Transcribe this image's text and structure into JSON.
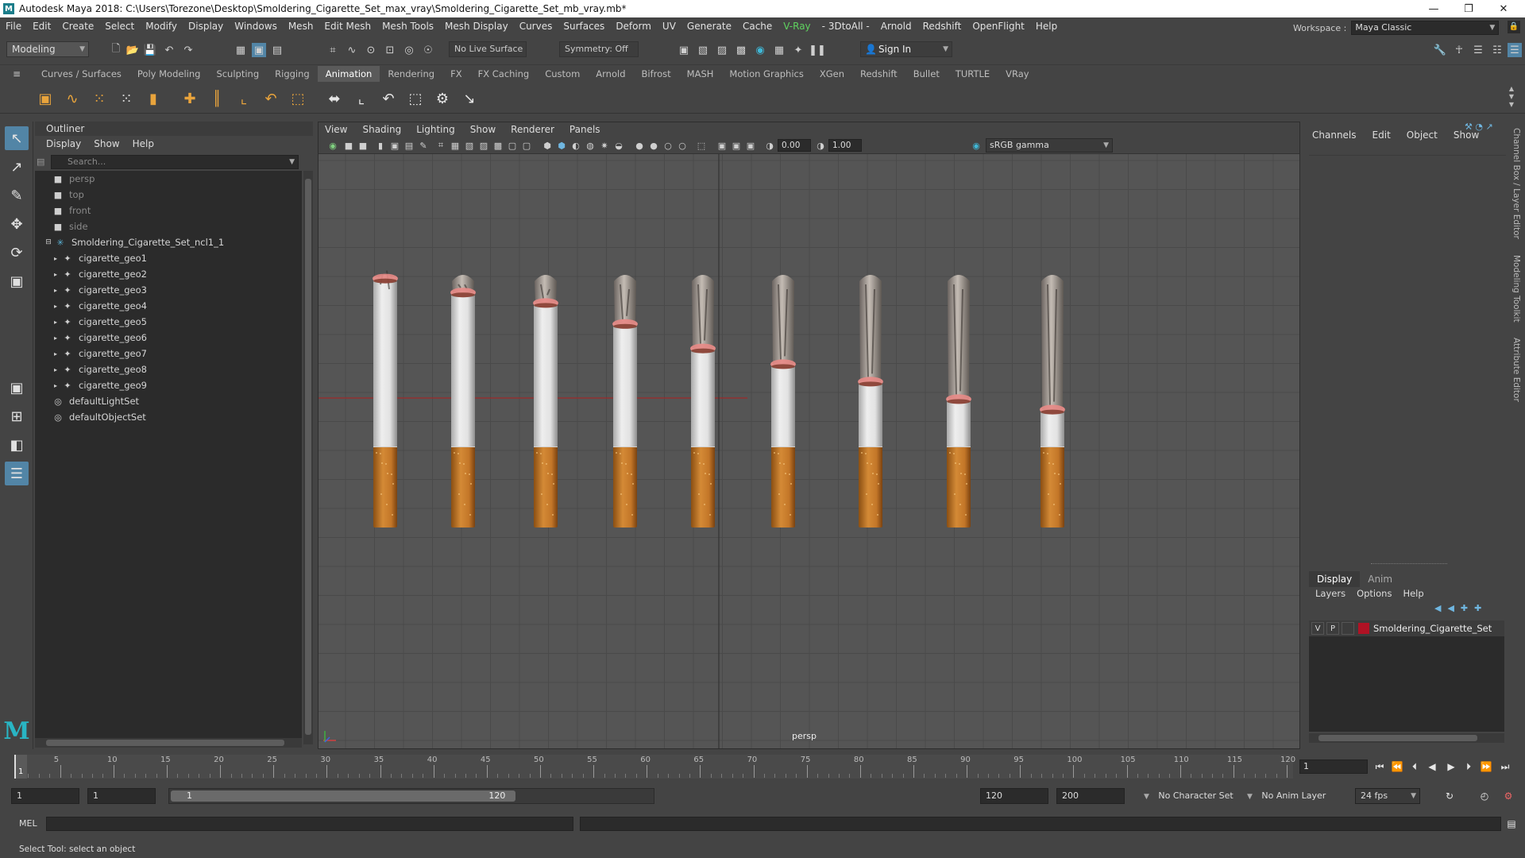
{
  "window": {
    "title": "Autodesk Maya 2018: C:\\Users\\Torezone\\Desktop\\Smoldering_Cigarette_Set_max_vray\\Smoldering_Cigarette_Set_mb_vray.mb*"
  },
  "menu": [
    "File",
    "Edit",
    "Create",
    "Select",
    "Modify",
    "Display",
    "Windows",
    "Mesh",
    "Edit Mesh",
    "Mesh Tools",
    "Mesh Display",
    "Curves",
    "Surfaces",
    "Deform",
    "UV",
    "Generate",
    "Cache",
    "V-Ray",
    "- 3DtoAll -",
    "Arnold",
    "Redshift",
    "OpenFlight",
    "Help"
  ],
  "workspace": {
    "label": "Workspace :",
    "value": "Maya Classic"
  },
  "status_line": {
    "mode": "Modeling",
    "live_surface": "No Live Surface",
    "symmetry": "Symmetry: Off",
    "sign_in": "Sign In"
  },
  "shelf_tabs": [
    "Curves / Surfaces",
    "Poly Modeling",
    "Sculpting",
    "Rigging",
    "Animation",
    "Rendering",
    "FX",
    "FX Caching",
    "Custom",
    "Arnold",
    "Bifrost",
    "MASH",
    "Motion Graphics",
    "XGen",
    "Redshift",
    "Bullet",
    "TURTLE",
    "VRay"
  ],
  "active_shelf_tab": "Animation",
  "outliner": {
    "title": "Outliner",
    "menu": [
      "Display",
      "Show",
      "Help"
    ],
    "search_placeholder": "Search...",
    "cameras": [
      "persp",
      "top",
      "front",
      "side"
    ],
    "group": "Smoldering_Cigarette_Set_ncl1_1",
    "children": [
      "cigarette_geo1",
      "cigarette_geo2",
      "cigarette_geo3",
      "cigarette_geo4",
      "cigarette_geo5",
      "cigarette_geo6",
      "cigarette_geo7",
      "cigarette_geo8",
      "cigarette_geo9"
    ],
    "sets": [
      "defaultLightSet",
      "defaultObjectSet"
    ]
  },
  "viewport": {
    "menu": [
      "View",
      "Shading",
      "Lighting",
      "Show",
      "Renderer",
      "Panels"
    ],
    "exposure": "0.00",
    "gamma": "1.00",
    "color_management": "sRGB gamma",
    "camera_label": "persp",
    "cigarette_burn_levels": [
      0.03,
      0.11,
      0.17,
      0.29,
      0.43,
      0.52,
      0.62,
      0.72,
      0.78
    ]
  },
  "channel_box": {
    "menu": [
      "Channels",
      "Edit",
      "Object",
      "Show"
    ],
    "layer_tabs": [
      "Display",
      "Anim"
    ],
    "layer_menu": [
      "Layers",
      "Options",
      "Help"
    ],
    "layer": {
      "visible_flag": "V",
      "playback_flag": "P",
      "name": "Smoldering_Cigarette_Set",
      "color": "#b01224"
    }
  },
  "side_tabs": [
    "Channel Box / Layer Editor",
    "Modeling Toolkit",
    "Attribute Editor"
  ],
  "time_slider": {
    "labels": [
      "1",
      "5",
      "10",
      "15",
      "20",
      "25",
      "30",
      "35",
      "40",
      "45",
      "50",
      "55",
      "60",
      "65",
      "70",
      "75",
      "80",
      "85",
      "90",
      "95",
      "100",
      "105",
      "110",
      "115",
      "120"
    ],
    "current_frame": "1"
  },
  "range_slider": {
    "start": "1",
    "playback_start": "1",
    "range_start_label": "1",
    "range_end_label": "120",
    "playback_end": "120",
    "end": "200",
    "character_set": "No Character Set",
    "anim_layer": "No Anim Layer",
    "fps": "24 fps"
  },
  "command_line": {
    "label": "MEL"
  },
  "help_line": "Select Tool: select an object"
}
